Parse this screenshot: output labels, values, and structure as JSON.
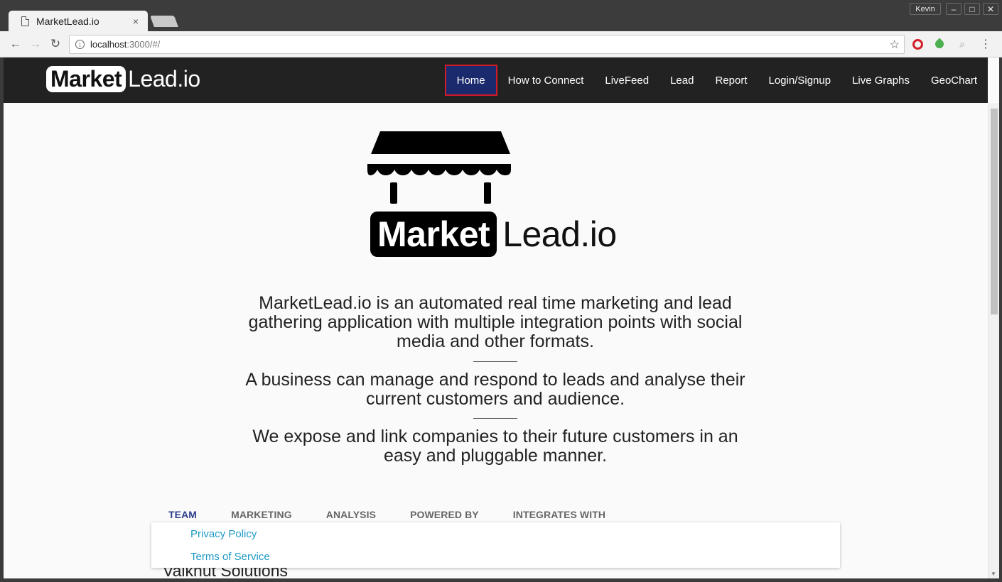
{
  "browser": {
    "tab_title": "MarketLead.io",
    "tab_close": "×",
    "user_name": "Kevin",
    "window_minimize": "–",
    "window_maximize": "□",
    "window_close": "✕",
    "nav_back": "←",
    "nav_forward": "→",
    "nav_reload": "↻",
    "url_host": "localhost",
    "url_path": ":3000/#/",
    "info_icon": "i",
    "bookmark_icon": "☆",
    "menu_icon": "⋮",
    "search_ext_icon": "⌕"
  },
  "header": {
    "brand_box": "Market",
    "brand_rest": "Lead.io",
    "nav": [
      {
        "label": "Home",
        "active": true
      },
      {
        "label": "How to Connect"
      },
      {
        "label": "LiveFeed"
      },
      {
        "label": "Lead"
      },
      {
        "label": "Report"
      },
      {
        "label": "Login/Signup"
      },
      {
        "label": "Live Graphs"
      },
      {
        "label": "GeoChart"
      }
    ]
  },
  "hero": {
    "word_box": "Market",
    "word_rest": "Lead.io"
  },
  "content": {
    "paragraphs": [
      "MarketLead.io is an automated real time marketing and lead gathering application with multiple integration points with social media and other formats.",
      "A business can manage and respond to leads and analyse their current customers and audience.",
      "We expose and link companies to their future customers in an easy and pluggable manner."
    ],
    "tabs": [
      "TEAM",
      "MARKETING",
      "ANALYSIS",
      "POWERED BY",
      "INTEGRATES WITH"
    ],
    "team_name": "Valknut Solutions"
  },
  "footer": {
    "links": [
      "Privacy Policy",
      "Terms of Service"
    ]
  },
  "colors": {
    "header_bg": "#222222",
    "active_nav_bg": "#1a2a6c",
    "active_nav_border": "#d11a2a",
    "link": "#1e9ac6",
    "active_tab": "#2d3e8c"
  }
}
